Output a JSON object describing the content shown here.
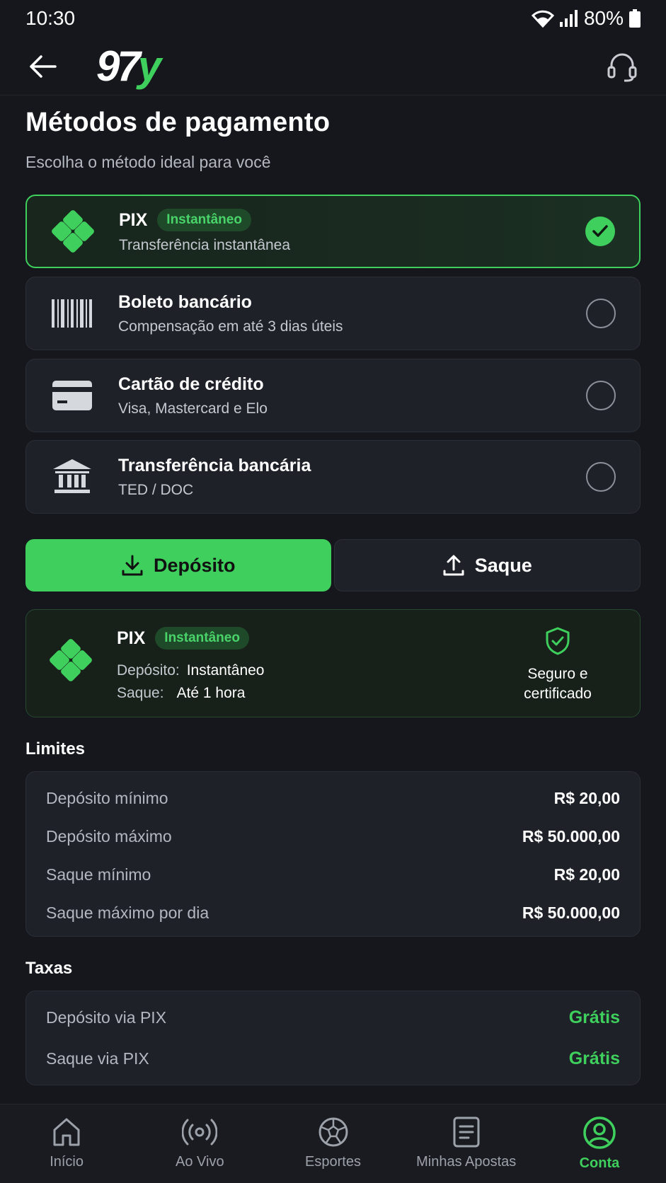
{
  "status_bar": {
    "time": "10:30",
    "battery": "80%"
  },
  "header": {
    "logo_number": "97",
    "logo_letter": "y"
  },
  "page": {
    "title": "Métodos de pagamento",
    "subtitle": "Escolha o método ideal para você"
  },
  "methods": [
    {
      "title": "PIX",
      "badge": "Instantâneo",
      "subtitle": "Transferência instantânea",
      "selected": true,
      "icon": "pix-icon"
    },
    {
      "title": "Boleto bancário",
      "subtitle": "Compensação em até 3 dias úteis",
      "selected": false,
      "icon": "barcode-icon"
    },
    {
      "title": "Cartão de crédito",
      "subtitle": "Visa, Mastercard e Elo",
      "selected": false,
      "icon": "credit-card-icon"
    },
    {
      "title": "Transferência bancária",
      "subtitle": "TED / DOC",
      "selected": false,
      "icon": "bank-icon"
    }
  ],
  "tabs": {
    "deposit": "Depósito",
    "withdraw": "Saque",
    "active": "deposit"
  },
  "info": {
    "title": "PIX",
    "badge": "Instantâneo",
    "deposit_label": "Depósito:",
    "deposit_value": "Instantâneo",
    "withdraw_label": "Saque:",
    "withdraw_value": "Até 1 hora",
    "secure_line1": "Seguro e",
    "secure_line2": "certificado"
  },
  "limits": {
    "title": "Limites",
    "rows": [
      {
        "label": "Depósito mínimo",
        "value": "R$ 20,00"
      },
      {
        "label": "Depósito máximo",
        "value": "R$ 50.000,00"
      },
      {
        "label": "Saque mínimo",
        "value": "R$ 20,00"
      },
      {
        "label": "Saque máximo por dia",
        "value": "R$ 50.000,00"
      }
    ]
  },
  "fees": {
    "title": "Taxas",
    "rows": [
      {
        "label": "Depósito via PIX",
        "value": "Grátis"
      },
      {
        "label": "Saque via PIX",
        "value": "Grátis"
      }
    ]
  },
  "nav": [
    {
      "label": "Início",
      "icon": "home-icon"
    },
    {
      "label": "Ao Vivo",
      "icon": "live-icon"
    },
    {
      "label": "Esportes",
      "icon": "soccer-ball-icon"
    },
    {
      "label": "Minhas Apostas",
      "icon": "bet-slip-icon"
    },
    {
      "label": "Conta",
      "icon": "account-icon",
      "active": true
    }
  ],
  "colors": {
    "accent": "#3ecf5d",
    "background": "#15171c",
    "card": "#1e2128"
  }
}
